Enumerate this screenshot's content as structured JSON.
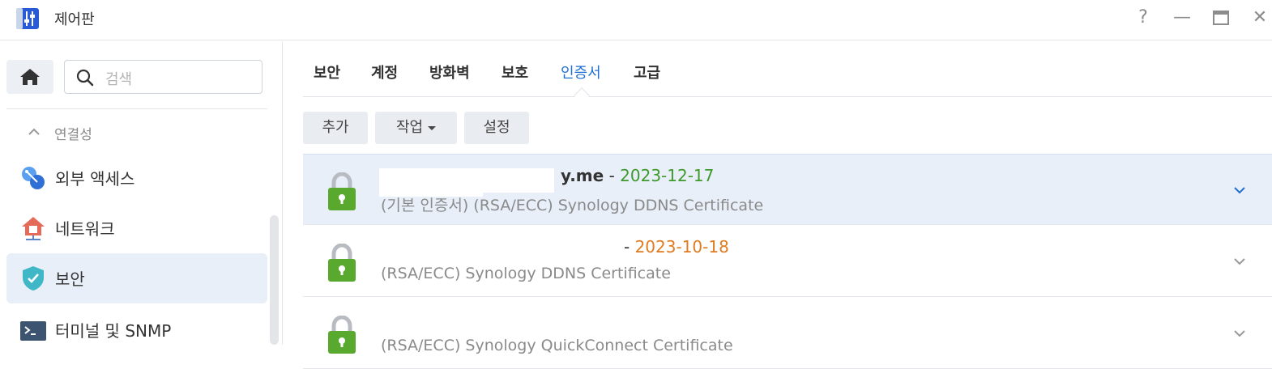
{
  "window": {
    "title": "제어판",
    "controls": {
      "help": "?",
      "minimize": "—",
      "maximize": "▭",
      "close": "✕"
    }
  },
  "sidebar": {
    "search_placeholder": "검색",
    "section": "연결성",
    "items": [
      {
        "label": "외부 액세스",
        "icon": "external-access-icon"
      },
      {
        "label": "네트워크",
        "icon": "network-house-icon"
      },
      {
        "label": "보안",
        "icon": "shield-icon",
        "active": true
      },
      {
        "label": "터미널 및 SNMP",
        "icon": "terminal-icon"
      }
    ]
  },
  "tabs": [
    {
      "label": "보안"
    },
    {
      "label": "계정"
    },
    {
      "label": "방화벽"
    },
    {
      "label": "보호"
    },
    {
      "label": "인증서",
      "active": true
    },
    {
      "label": "고급"
    }
  ],
  "toolbar": {
    "add_label": "추가",
    "action_label": "작업",
    "settings_label": "설정"
  },
  "certificates": [
    {
      "domain": "y.me",
      "separator": "-",
      "date": "2023-12-17",
      "date_status": "valid",
      "description": "(기본 인증서) (RSA/ECC) Synology DDNS Certificate"
    },
    {
      "domain": "",
      "separator": "-",
      "date": "2023-10-18",
      "date_status": "expiring",
      "description": "(RSA/ECC) Synology DDNS Certificate"
    },
    {
      "domain": "",
      "separator": "",
      "date": "",
      "date_status": "",
      "description": "(RSA/ECC) Synology QuickConnect Certificate"
    }
  ],
  "colors": {
    "accent": "#1f6fd1",
    "valid_date": "#3d9a2a",
    "expiring_date": "#e07b1f",
    "lock_green": "#5aa92f",
    "selected_bg": "#e8eff9"
  }
}
